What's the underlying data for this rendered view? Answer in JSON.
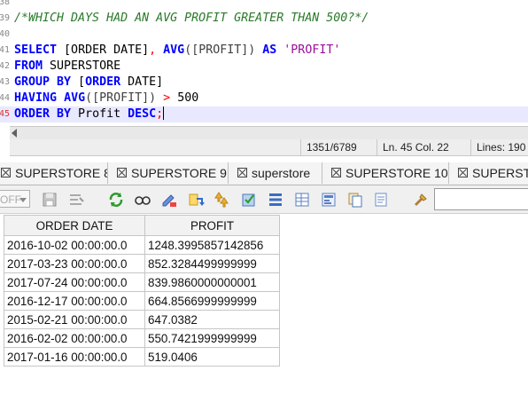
{
  "editor": {
    "lines": [
      {
        "num": "38",
        "tokens": []
      },
      {
        "num": "39",
        "tokens": [
          {
            "t": "/*WHICH DAYS HAD AN AVG PROFIT GREATER THAN 500?*/",
            "c": "cm"
          }
        ]
      },
      {
        "num": "40",
        "tokens": []
      },
      {
        "num": "41",
        "tokens": [
          {
            "t": "SELECT",
            "c": "kw"
          },
          {
            "t": " [ORDER DATE]",
            "c": "tx"
          },
          {
            "t": ",",
            "c": "op"
          },
          {
            "t": " ",
            "c": "tx"
          },
          {
            "t": "AVG",
            "c": "kw"
          },
          {
            "t": "([PROFIT])",
            "c": "pu"
          },
          {
            "t": " ",
            "c": "tx"
          },
          {
            "t": "AS",
            "c": "kw"
          },
          {
            "t": " ",
            "c": "tx"
          },
          {
            "t": "'PROFIT'",
            "c": "st"
          }
        ]
      },
      {
        "num": "42",
        "tokens": [
          {
            "t": "FROM",
            "c": "kw"
          },
          {
            "t": " SUPERSTORE",
            "c": "tx"
          }
        ]
      },
      {
        "num": "43",
        "tokens": [
          {
            "t": "GROUP BY",
            "c": "kw"
          },
          {
            "t": " [",
            "c": "tx"
          },
          {
            "t": "ORDER",
            "c": "kw"
          },
          {
            "t": " DATE]",
            "c": "tx"
          }
        ]
      },
      {
        "num": "44",
        "tokens": [
          {
            "t": "HAVING",
            "c": "kw"
          },
          {
            "t": " ",
            "c": "tx"
          },
          {
            "t": "AVG",
            "c": "kw"
          },
          {
            "t": "([PROFIT])",
            "c": "pu"
          },
          {
            "t": " ",
            "c": "tx"
          },
          {
            "t": ">",
            "c": "op"
          },
          {
            "t": " 500",
            "c": "tx"
          }
        ]
      },
      {
        "num": "45",
        "current": true,
        "tokens": [
          {
            "t": "ORDER BY",
            "c": "kw"
          },
          {
            "t": " Profit ",
            "c": "tx"
          },
          {
            "t": "DESC",
            "c": "kw"
          },
          {
            "t": ";",
            "c": "op"
          }
        ]
      }
    ]
  },
  "status": {
    "position": "1351/6789",
    "line_col": "Ln. 45 Col. 22",
    "lines": "Lines: 190"
  },
  "tabs": [
    {
      "label": "SUPERSTORE 8"
    },
    {
      "label": "SUPERSTORE 9"
    },
    {
      "label": "superstore"
    },
    {
      "label": "SUPERSTORE 10"
    },
    {
      "label": "SUPERSTO"
    }
  ],
  "toolbar": {
    "mode_select_value": "OFF",
    "icons": [
      "save-icon",
      "format-icon",
      "refresh-icon",
      "find-icon",
      "edit-icon",
      "add-row-icon",
      "insert-icon",
      "apply-icon",
      "list-icon",
      "grid-icon",
      "form-icon",
      "copy-icon",
      "export-icon",
      "tools-icon"
    ]
  },
  "results": {
    "columns": [
      "ORDER DATE",
      "PROFIT"
    ],
    "rows": [
      [
        "2016-10-02 00:00:00.0",
        "1248.3995857142856"
      ],
      [
        "2017-03-23 00:00:00.0",
        "852.3284499999999"
      ],
      [
        "2017-07-24 00:00:00.0",
        "839.9860000000001"
      ],
      [
        "2016-12-17 00:00:00.0",
        "664.8566999999999"
      ],
      [
        "2015-02-21 00:00:00.0",
        "647.0382"
      ],
      [
        "2016-02-02 00:00:00.0",
        "550.7421999999999"
      ],
      [
        "2017-01-16 00:00:00.0",
        "519.0406"
      ]
    ]
  }
}
